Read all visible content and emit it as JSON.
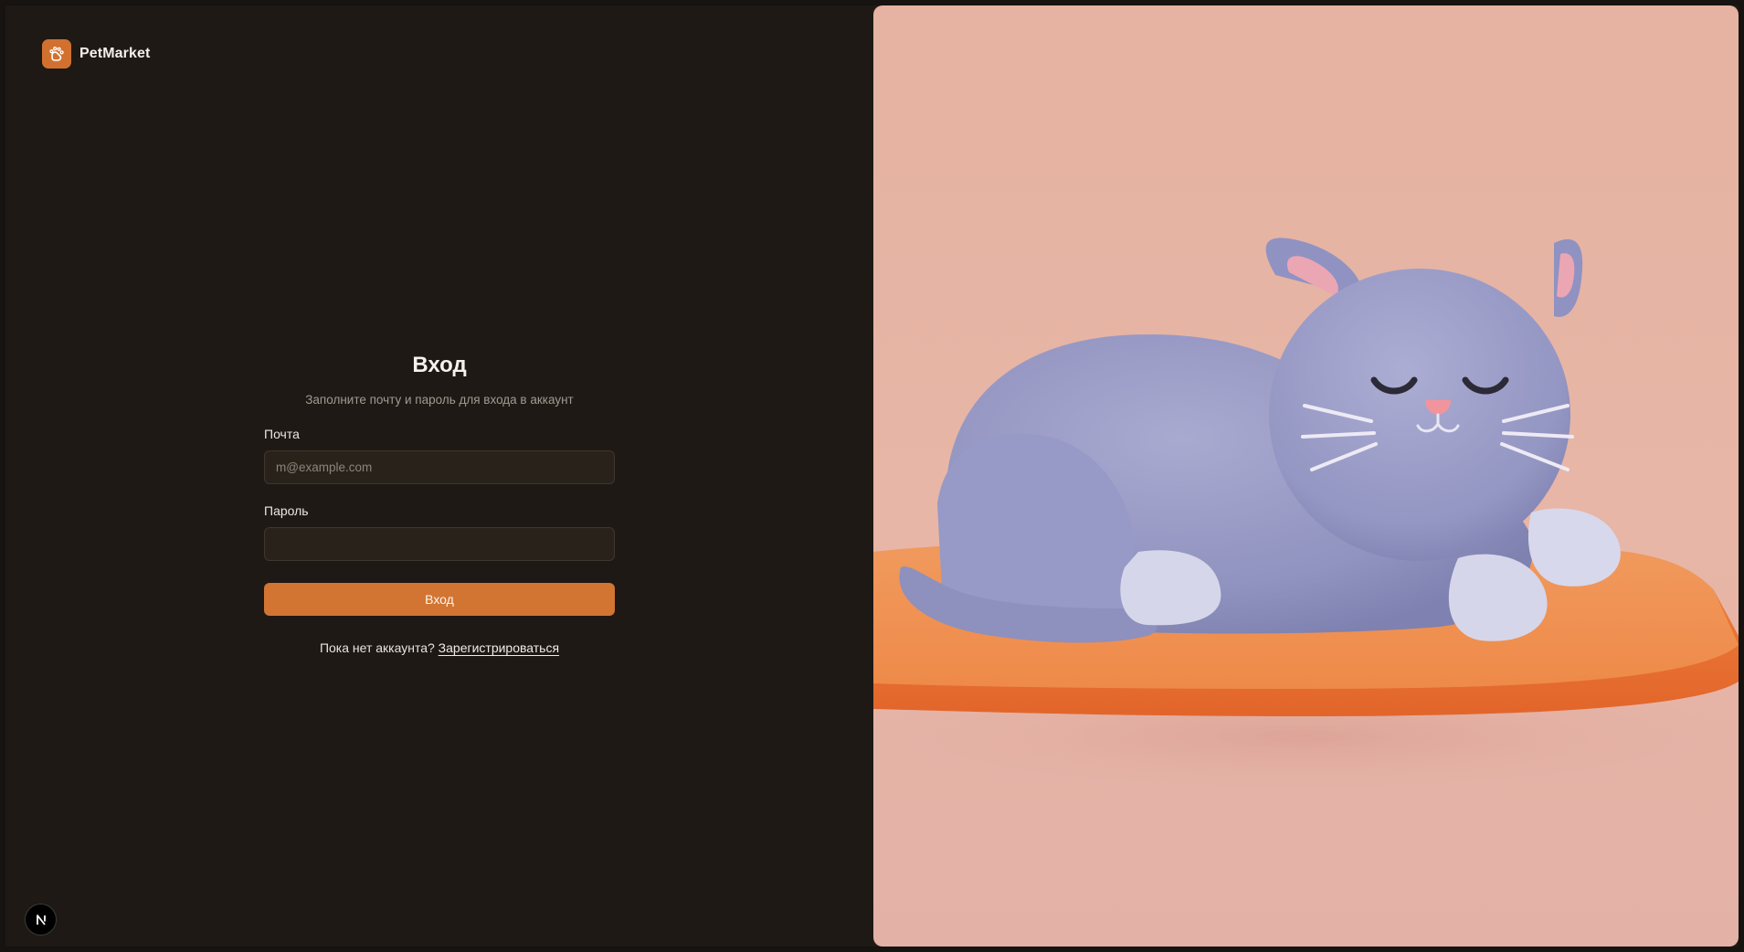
{
  "brand": {
    "name": "PetMarket",
    "logo_icon": "paw-icon",
    "accent_color": "#d2712f"
  },
  "login_form": {
    "title": "Вход",
    "subtitle": "Заполните почту и пароль для входа в аккаунт",
    "email_label": "Почта",
    "email_placeholder": "m@example.com",
    "email_value": "",
    "password_label": "Пароль",
    "password_value": "",
    "submit_label": "Вход",
    "signup_prompt": "Пока нет аккаунта?",
    "signup_link": "Зарегистрироваться"
  },
  "dev_badge": {
    "letter": "N",
    "icon": "nextjs-icon"
  },
  "hero": {
    "image": "sleeping-cat-illustration",
    "colors": {
      "background": "#e6b2a1",
      "cat": "#9fa1c7",
      "cushion": "#ee8a4a"
    }
  }
}
